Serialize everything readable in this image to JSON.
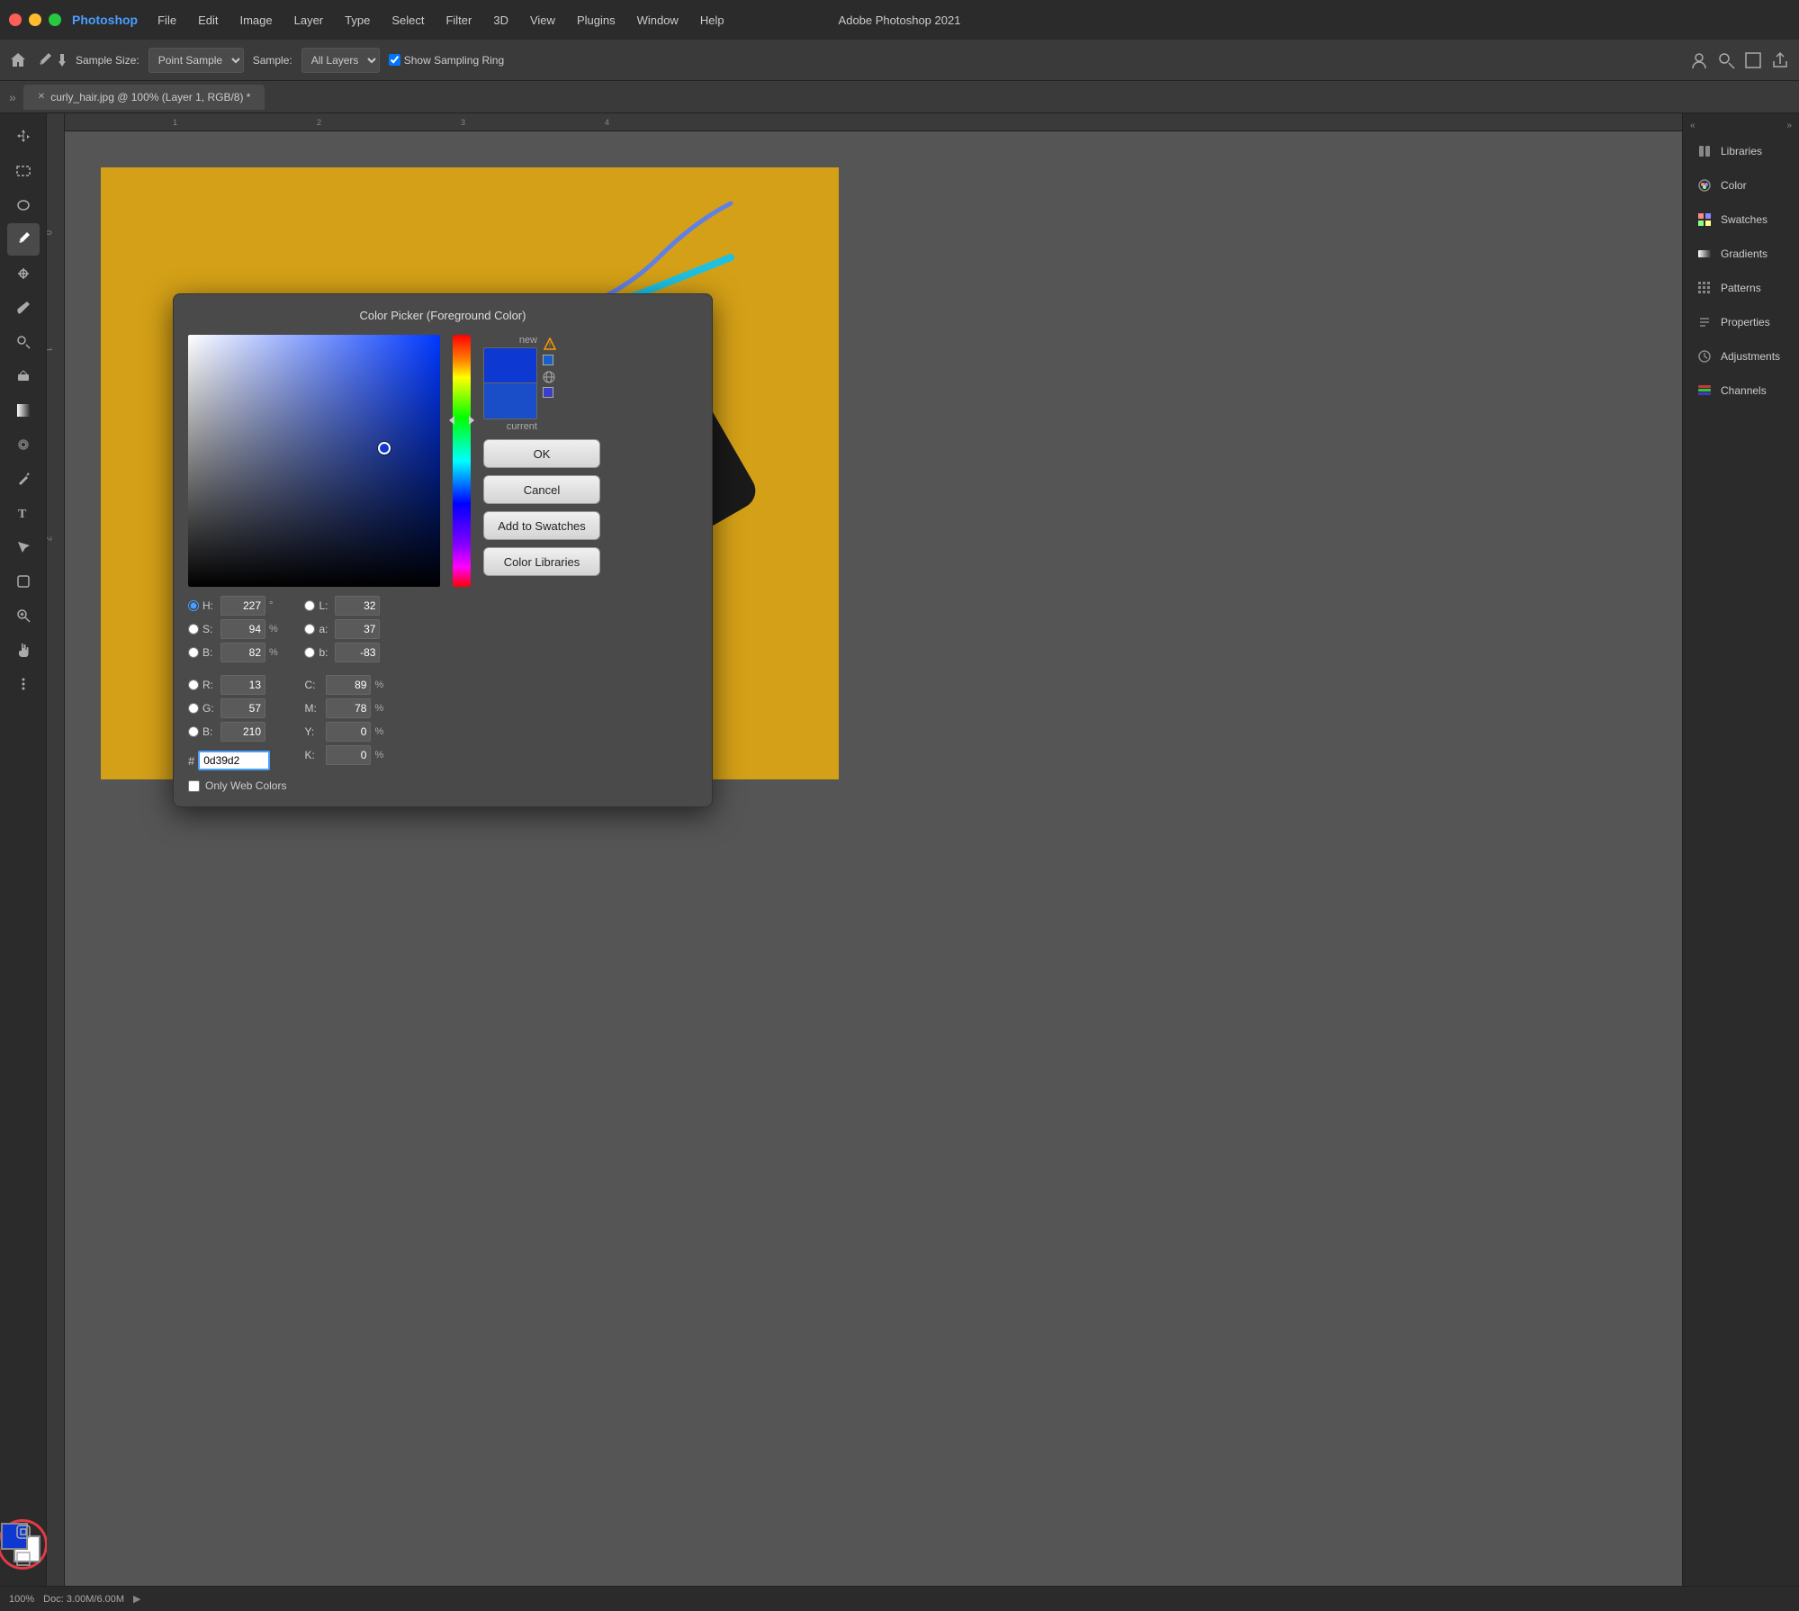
{
  "app": {
    "name": "Photoshop",
    "window_title": "Adobe Photoshop 2021"
  },
  "menu": {
    "items": [
      "File",
      "Edit",
      "Image",
      "Layer",
      "Type",
      "Select",
      "Filter",
      "3D",
      "View",
      "Plugins",
      "Window",
      "Help"
    ]
  },
  "options_bar": {
    "sample_size_label": "Sample Size:",
    "sample_size_value": "Point Sample",
    "sample_label": "Sample:",
    "sample_value": "All Layers",
    "show_sampling_ring": "Show Sampling Ring"
  },
  "tab": {
    "title": "curly_hair.jpg @ 100% (Layer 1, RGB/8) *"
  },
  "color_picker": {
    "title": "Color Picker (Foreground Color)",
    "new_label": "new",
    "current_label": "current",
    "ok_label": "OK",
    "cancel_label": "Cancel",
    "add_to_swatches_label": "Add to Swatches",
    "color_libraries_label": "Color Libraries",
    "h_label": "H:",
    "h_value": "227",
    "h_unit": "°",
    "s_label": "S:",
    "s_value": "94",
    "s_unit": "%",
    "b_label": "B:",
    "b_value": "82",
    "b_unit": "%",
    "r_label": "R:",
    "r_value": "13",
    "g_label": "G:",
    "g_value": "57",
    "bl_label": "B:",
    "bl_value": "210",
    "l_label": "L:",
    "l_value": "32",
    "a_label": "a:",
    "a_value": "37",
    "b2_label": "b:",
    "b2_value": "-83",
    "c_label": "C:",
    "c_value": "89",
    "c_unit": "%",
    "m_label": "M:",
    "m_value": "78",
    "m_unit": "%",
    "y_label": "Y:",
    "y_value": "0",
    "y_unit": "%",
    "k_label": "K:",
    "k_value": "0",
    "k_unit": "%",
    "hex_label": "#",
    "hex_value": "0d39d2",
    "only_web_colors": "Only Web Colors",
    "new_color": "#0d39d2",
    "current_color": "#1a4ec8"
  },
  "right_panel": {
    "items": [
      {
        "label": "Libraries",
        "icon": "libraries-icon"
      },
      {
        "label": "Color",
        "icon": "color-icon"
      },
      {
        "label": "Swatches",
        "icon": "swatches-icon"
      },
      {
        "label": "Gradients",
        "icon": "gradient-icon"
      },
      {
        "label": "Patterns",
        "icon": "patterns-icon"
      },
      {
        "label": "Properties",
        "icon": "properties-icon"
      },
      {
        "label": "Adjustments",
        "icon": "adjustments-icon"
      },
      {
        "label": "Channels",
        "icon": "channels-icon"
      }
    ]
  },
  "tools": {
    "items": [
      "move",
      "select-rect",
      "lasso",
      "eyedropper",
      "healing",
      "brush",
      "clone",
      "eraser",
      "gradient",
      "blur",
      "pen",
      "type",
      "path-select",
      "shape",
      "zoom",
      "hand",
      "more"
    ]
  },
  "status_bar": {
    "zoom": "100%",
    "doc_size": "Doc: 3.00M/6.00M"
  }
}
